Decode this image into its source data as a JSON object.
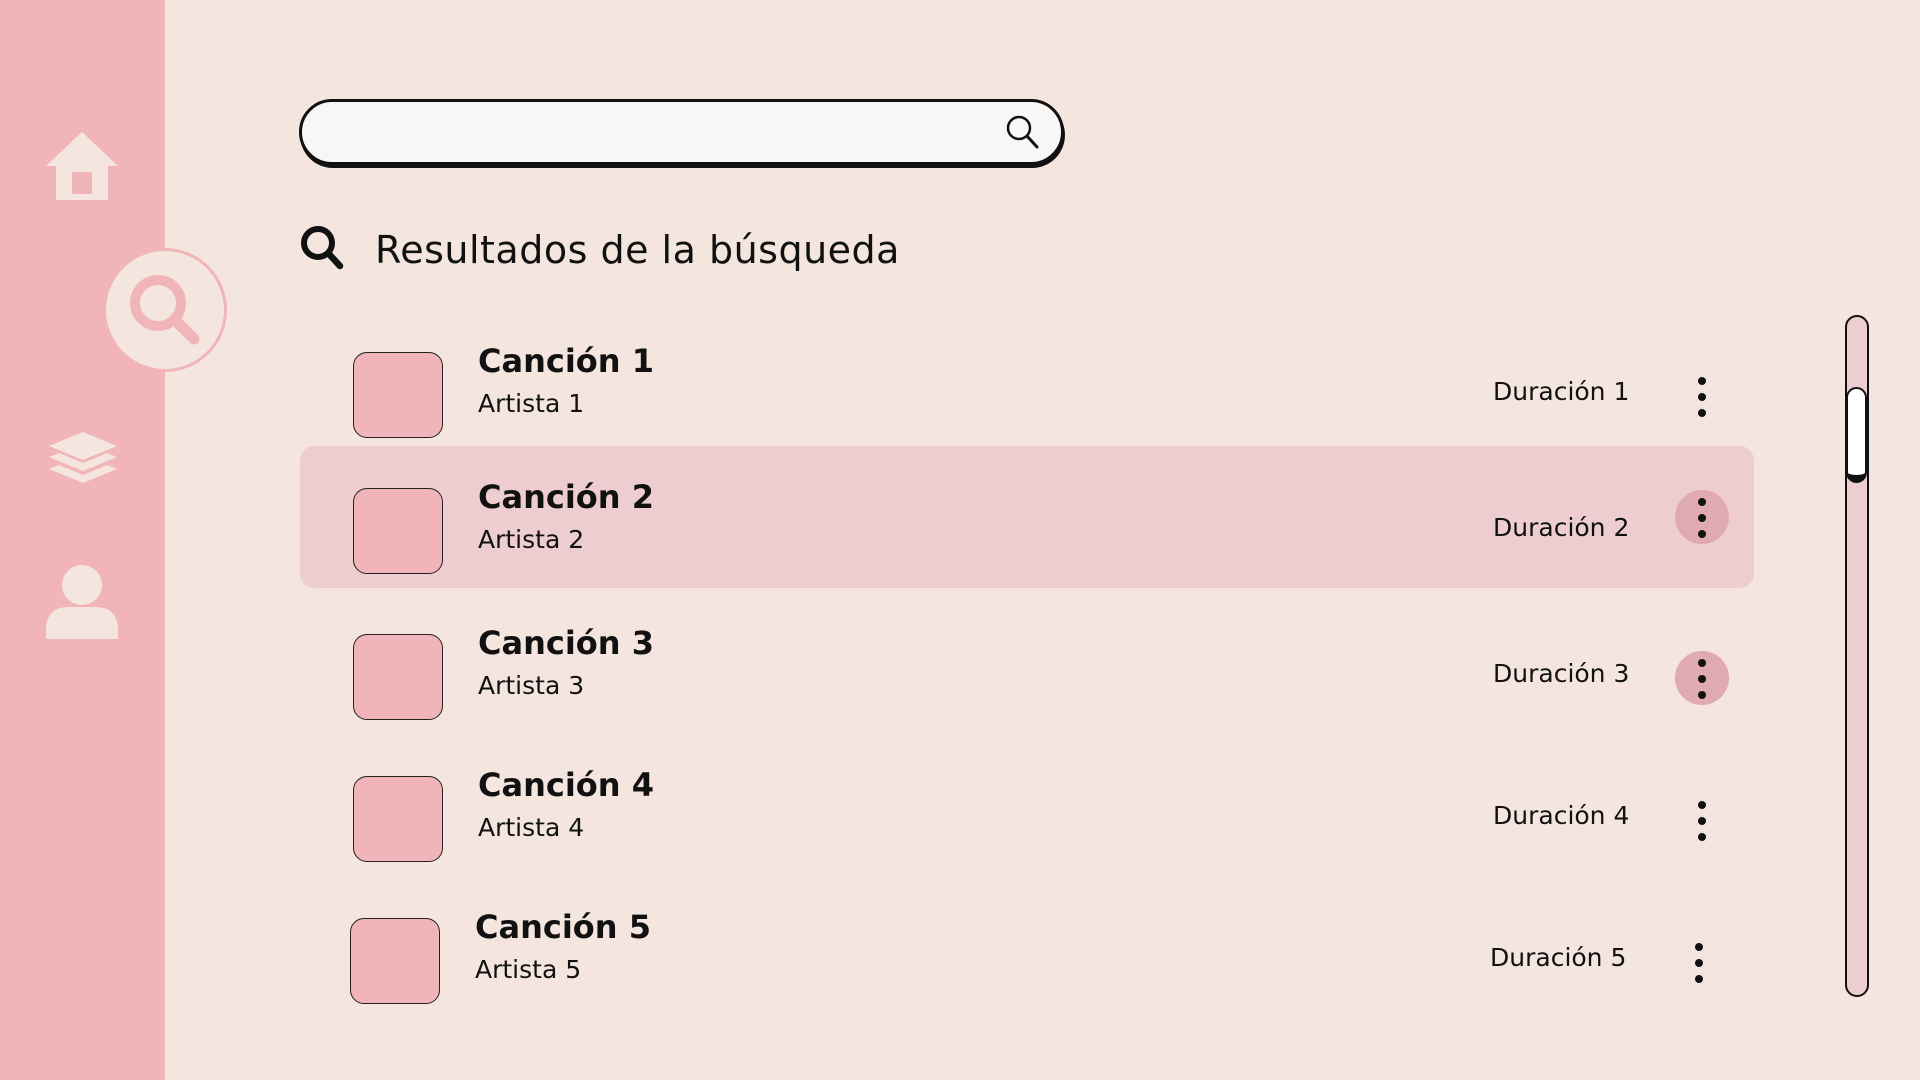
{
  "colors": {
    "background": "#F4E6DF",
    "sidebar": "#F1B4B9",
    "sidebar_icon": "#F4E6DF",
    "highlight_row": "#EDCDD0",
    "thumbnail": "#F1B4B9",
    "more_button_active": "#DFAAB0",
    "text": "#111111"
  },
  "sidebar": {
    "items": [
      {
        "name": "home",
        "icon": "home-icon",
        "active": false
      },
      {
        "name": "search",
        "icon": "search-icon",
        "active": true
      },
      {
        "name": "library",
        "icon": "layers-icon",
        "active": false
      },
      {
        "name": "profile",
        "icon": "user-icon",
        "active": false
      }
    ]
  },
  "search": {
    "value": "",
    "placeholder": "",
    "icon": "search-icon"
  },
  "results": {
    "title": "Resultados de la búsqueda",
    "icon": "search-icon",
    "songs": [
      {
        "title": "Canción 1",
        "artist": "Artista 1",
        "duration": "Duración 1",
        "highlighted": false,
        "more_active": false
      },
      {
        "title": "Canción 2",
        "artist": "Artista 2",
        "duration": "Duración 2",
        "highlighted": true,
        "more_active": true
      },
      {
        "title": "Canción 3",
        "artist": "Artista 3",
        "duration": "Duración 3",
        "highlighted": false,
        "more_active": true
      },
      {
        "title": "Canción 4",
        "artist": "Artista 4",
        "duration": "Duración 4",
        "highlighted": false,
        "more_active": false
      },
      {
        "title": "Canción 5",
        "artist": "Artista 5",
        "duration": "Duración 5",
        "highlighted": false,
        "more_active": false
      }
    ],
    "more_icon": "more-vertical-icon"
  },
  "scrollbar": {
    "position": 0.12
  }
}
